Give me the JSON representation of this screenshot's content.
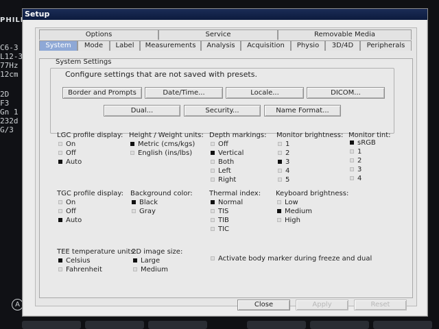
{
  "bezel": {
    "brand": "PHILIPS",
    "lines": [
      "C6-3",
      "L12-3",
      "77Hz",
      "12cm",
      "",
      "2D",
      "F3",
      "Gn 1",
      "232d",
      "G/3"
    ],
    "circle": "A"
  },
  "window": {
    "title": "Setup",
    "tabs_top": [
      "Options",
      "Service",
      "Removable Media"
    ],
    "tabs_bottom": [
      "System",
      "Mode",
      "Label",
      "Measurements",
      "Analysis",
      "Acquisition",
      "Physio",
      "3D/4D",
      "Peripherals"
    ],
    "active_tab": "System",
    "system_settings": {
      "heading": "System Settings",
      "description": "Configure settings that are not saved with presets.",
      "buttons": [
        "Border and Prompts",
        "Date/Time...",
        "Locale...",
        "DICOM...",
        "Dual...",
        "Security...",
        "Name Format..."
      ]
    },
    "lgc": {
      "label": "LGC profile display:",
      "options": [
        "On",
        "Off",
        "Auto"
      ],
      "selected": "Auto"
    },
    "units": {
      "label": "Height / Weight units:",
      "options": [
        "Metric (cms/kgs)",
        "English (ins/lbs)"
      ],
      "selected": "Metric (cms/kgs)"
    },
    "depth": {
      "label": "Depth markings:",
      "options": [
        "Off",
        "Vertical",
        "Both",
        "Left",
        "Right"
      ],
      "selected": "Vertical"
    },
    "monitor_brightness": {
      "label": "Monitor brightness:",
      "options": [
        "1",
        "2",
        "3",
        "4",
        "5"
      ],
      "selected": "3"
    },
    "monitor_tint": {
      "label": "Monitor tint:",
      "options": [
        "sRGB",
        "1",
        "2",
        "3",
        "4"
      ],
      "selected": "sRGB"
    },
    "tgc": {
      "label": "TGC profile display:",
      "options": [
        "On",
        "Off",
        "Auto"
      ],
      "selected": "Auto"
    },
    "background": {
      "label": "Background color:",
      "options": [
        "Black",
        "Gray"
      ],
      "selected": "Black"
    },
    "thermal": {
      "label": "Thermal index:",
      "options": [
        "Normal",
        "TIS",
        "TIB",
        "TIC"
      ],
      "selected": "Normal"
    },
    "keyboard_brightness": {
      "label": "Keyboard brightness:",
      "options": [
        "Low",
        "Medium",
        "High"
      ],
      "selected": "Medium"
    },
    "tee": {
      "label": "TEE temperature units:",
      "options": [
        "Celsius",
        "Fahrenheit"
      ],
      "selected": "Celsius"
    },
    "image_size": {
      "label": "2D image size:",
      "options": [
        "Large",
        "Medium"
      ],
      "selected": "Large"
    },
    "body_marker": {
      "label": "Activate body marker during freeze and dual",
      "checked": false
    },
    "footer": {
      "close": "Close",
      "apply": "Apply",
      "reset": "Reset"
    }
  }
}
